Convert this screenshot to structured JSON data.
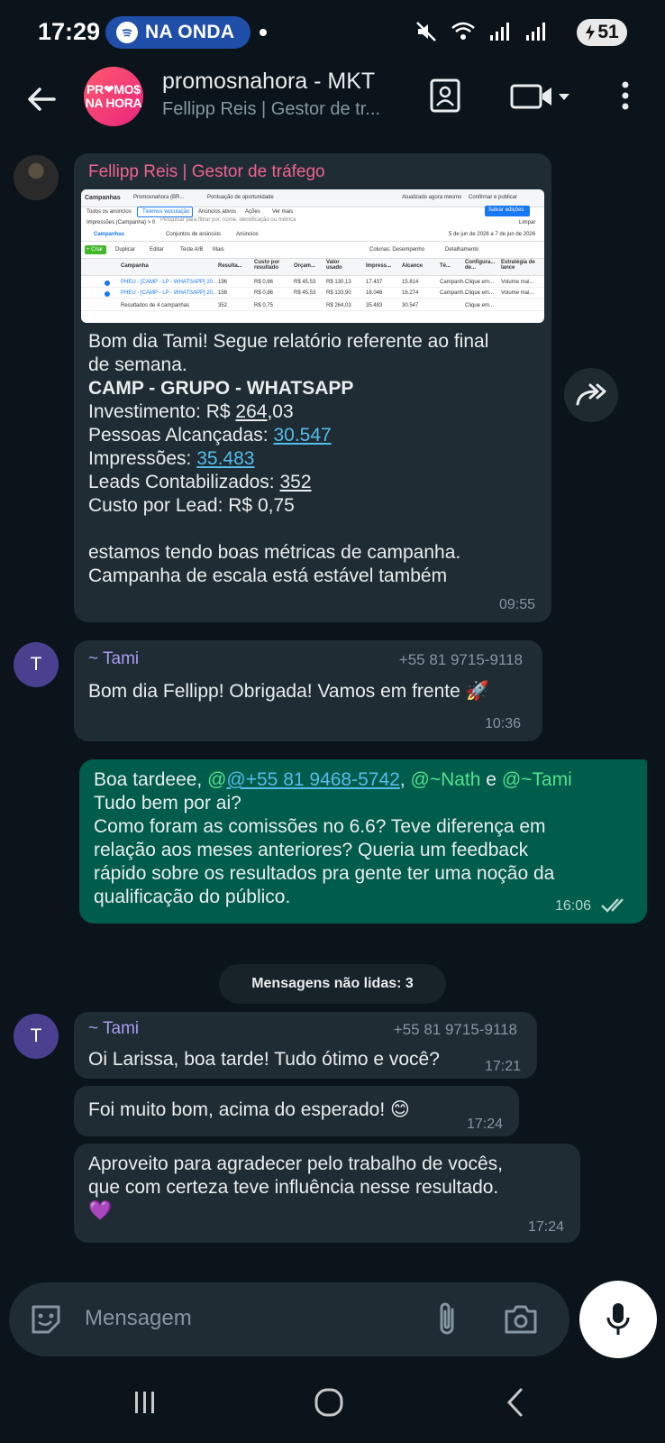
{
  "status_bar": {
    "time": "17:29",
    "pill_label": "NA ONDA",
    "battery": "51"
  },
  "header": {
    "avatar_line1": "PR❤MO$",
    "avatar_line2": "NA HORA",
    "title": "promosnahora - MKT",
    "subtitle": "Fellipp Reis | Gestor de tr..."
  },
  "messages": [
    {
      "sender": "Fellipp Reis | Gestor de tráfego",
      "lines": {
        "l1": "Bom dia Tami! Segue relatório referente ao final",
        "l2": "de semana.",
        "l3": "CAMP - GRUPO - WHATSAPP",
        "inv_label": "Investimento: R$ ",
        "inv_under": "264",
        "inv_rest": ",03",
        "reach_label": "Pessoas Alcançadas: ",
        "reach_value": "30.547",
        "impr_label": "Impressões: ",
        "impr_value": "35.483",
        "leads_label": "Leads Contabilizados: ",
        "leads_value": "352",
        "cpl": "Custo por Lead: R$ 0,75",
        "l9": "estamos tendo boas métricas de campanha.",
        "l10": "Campanha de escala está estável também"
      },
      "time": "09:55",
      "thumbnail": {
        "tab_title": "Campanhas",
        "account": "Promosnahora (BR...",
        "breadcrumb": "Pontuação de oportunidade",
        "updated": "Atualizado agora mesmo",
        "btn_confirm": "Confirmar e publicar",
        "btn_save": "Salvar edições",
        "tab_all": "Todos os anúncios",
        "tab_view": "Tivemos veiculação",
        "tab_active": "Anúncios ativos",
        "tab_actions": "Ações",
        "tab_more": "Ver mais",
        "filter": "Impressões (Campanha) > 0",
        "filter_hint": "Pesquisar para filtrar por: nome, identificação ou métrica",
        "clear": "Limpar",
        "date_range": "5 de jun de 2026 a 7 de jun de 2026",
        "nav_campaigns": "Campanhas",
        "nav_adsets": "Conjuntos de anúncios",
        "nav_ads": "Anúncios",
        "btn_create": "+ Criar",
        "btn_duplicate": "Duplicar",
        "btn_edit": "Editar",
        "btn_ab": "Teste A/B",
        "btn_more": "Mais",
        "columns": "Colunas: Desempenho",
        "breakdown": "Detalhamento",
        "col_headers": [
          "Campanha",
          "Resulta...",
          "Custo por resultado",
          "Orçam...",
          "Valor usado",
          "Impress...",
          "Alcance",
          "Té...",
          "Configura... de...",
          "Estratégia de lance"
        ],
        "rows": [
          [
            "PHEU - [CAMP - LP - WHATSAPP] 20...",
            "196",
            "R$ 0,66",
            "R$ 45,53",
            "R$ 130,13",
            "17.437",
            "15.814",
            "Campanh...",
            "Clique em...",
            "Volume mai..."
          ],
          [
            "PHEU - [CAMP - LP - WHATSAPP] 20...",
            "156",
            "R$ 0,86",
            "R$ 45,53",
            "R$ 133,90",
            "18.046",
            "16.274",
            "Campanh...",
            "Clique em...",
            "Volume mai..."
          ],
          [
            "Resultados de 4 campanhas",
            "352",
            "R$ 0,75",
            "",
            "R$ 264,03",
            "35.483",
            "30.547",
            "",
            "Clique em...",
            ""
          ]
        ]
      }
    },
    {
      "sender": "~ Tami",
      "phone": "+55 81 9715-9118",
      "avatar": "T",
      "text": "Bom dia Fellipp! Obrigada! Vamos em frente 🚀",
      "time": "10:36"
    },
    {
      "mention1": "@+55 81 9468-5742",
      "mention2": "@~Nath",
      "mention3": "@~Tami",
      "prefix": "Boa tardeee, ",
      "sep1": ", ",
      "sep2": " e ",
      "l2": "Tudo bem por ai?",
      "l3": "Como foram as comissões no 6.6? Teve diferença em",
      "l4": "relação aos meses anteriores? Queria um feedback",
      "l5": "rápido sobre os resultados pra gente ter uma noção da",
      "l6": "qualificação do público.",
      "time": "16:06"
    },
    {
      "sender": "~ Tami",
      "phone": "+55 81 9715-9118",
      "avatar": "T",
      "text": "Oi Larissa, boa tarde! Tudo ótimo e você?",
      "time": "17:21"
    },
    {
      "text": "Foi muito bom, acima do esperado! 😊",
      "time": "17:24"
    },
    {
      "l1": "Aproveito para agradecer pelo trabalho de vocês,",
      "l2": "que com certeza teve influência nesse resultado.",
      "l3": "💜",
      "time": "17:24"
    }
  ],
  "unread_divider": "Mensagens não lidas: 3",
  "composer": {
    "placeholder": "Mensagem"
  },
  "colors": {
    "background": "#0b141a",
    "incoming_bubble": "#202c33",
    "outgoing_bubble": "#005c4b",
    "sender_fellipp": "#f06292",
    "sender_tami": "#a99cf2",
    "link": "#53bdeb"
  }
}
